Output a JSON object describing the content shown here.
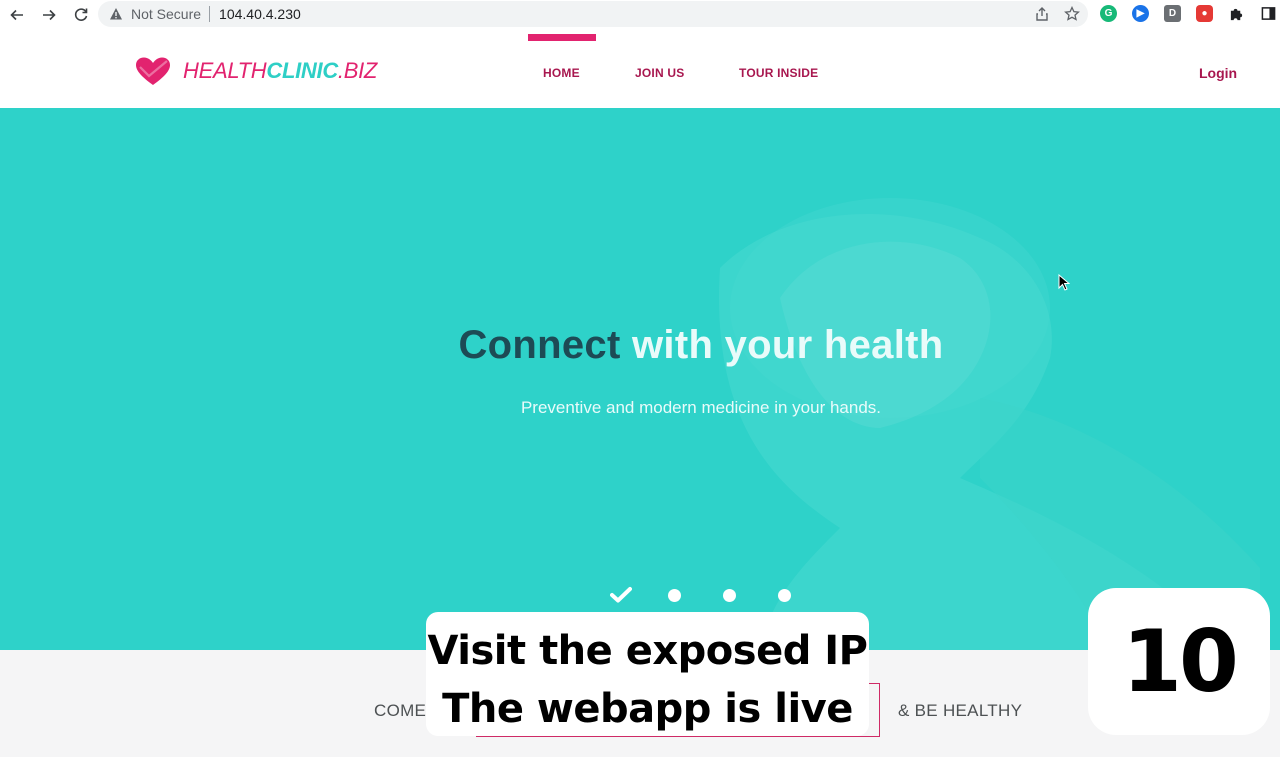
{
  "browser": {
    "security_label": "Not Secure",
    "url": "104.40.4.230",
    "extensions": [
      {
        "name": "grammarly-icon",
        "glyph": "G"
      },
      {
        "name": "extension-blue-icon",
        "glyph": "▶"
      },
      {
        "name": "extension-d-icon",
        "glyph": "D"
      },
      {
        "name": "extension-red-icon",
        "glyph": "●"
      }
    ]
  },
  "header": {
    "logo": {
      "part1": "HEALTH",
      "part2": "CLINIC",
      "part3": ".BIZ"
    },
    "nav": [
      {
        "label": "HOME",
        "active": true
      },
      {
        "label": "JOIN US",
        "active": false
      },
      {
        "label": "TOUR INSIDE",
        "active": false
      }
    ],
    "login_label": "Login"
  },
  "hero": {
    "title_dark": "Connect",
    "title_light": "with your health",
    "subtitle": "Preventive and modern medicine in your hands.",
    "slides": 4,
    "active_slide": 1
  },
  "strip": {
    "left_text": "COME",
    "right_text": "& BE HEALTHY"
  },
  "overlay": {
    "caption_line1": "Visit the exposed IP",
    "caption_line2": "The webapp is live",
    "badge": "10"
  },
  "colors": {
    "accent": "#e2236f",
    "nav_text": "#a8174f",
    "hero_bg": "#2ed2c9",
    "logo_teal": "#2ecfc6"
  }
}
